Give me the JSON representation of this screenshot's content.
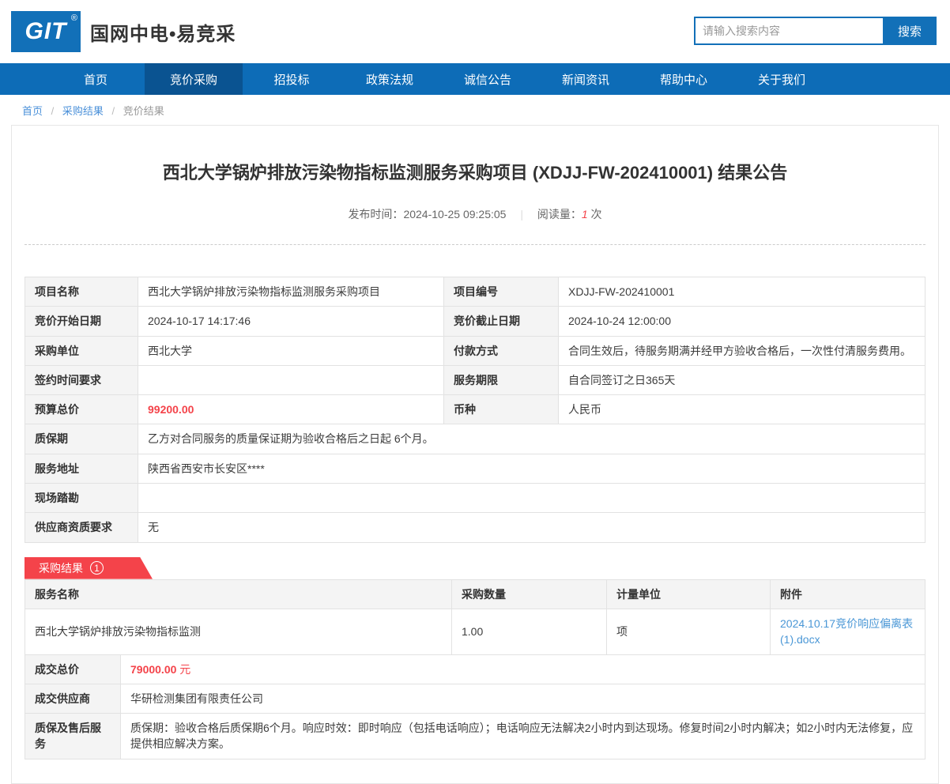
{
  "colors": {
    "primary_blue": "#0d6cb7",
    "active_nav_blue": "#0a5391",
    "logo_blue": "#1270b8",
    "accent_red": "#f4434a",
    "link_blue": "#4a97d6"
  },
  "header": {
    "logo_text": "GIT",
    "logo_registered": "®",
    "site_name": "国网中电•易竞采",
    "search_placeholder": "请输入搜索内容",
    "search_button": "搜索"
  },
  "nav": {
    "items": [
      {
        "label": "首页"
      },
      {
        "label": "竞价采购"
      },
      {
        "label": "招投标"
      },
      {
        "label": "政策法规"
      },
      {
        "label": "诚信公告"
      },
      {
        "label": "新闻资讯"
      },
      {
        "label": "帮助中心"
      },
      {
        "label": "关于我们"
      }
    ]
  },
  "breadcrumb": {
    "home": "首页",
    "sep": "/",
    "level1": "采购结果",
    "level2": "竞价结果"
  },
  "article": {
    "title": "西北大学锅炉排放污染物指标监测服务采购项目 (XDJJ-FW-202410001) 结果公告",
    "publish_label": "发布时间：",
    "publish_time": "2024-10-25 09:25:05",
    "divider": "|",
    "views_label": "阅读量：",
    "views_count": "1",
    "views_unit": "次"
  },
  "details": {
    "project_name_label": "项目名称",
    "project_name": "西北大学锅炉排放污染物指标监测服务采购项目",
    "project_no_label": "项目编号",
    "project_no": "XDJJ-FW-202410001",
    "start_label": "竞价开始日期",
    "start": "2024-10-17 14:17:46",
    "end_label": "竞价截止日期",
    "end": "2024-10-24 12:00:00",
    "buyer_label": "采购单位",
    "buyer": "西北大学",
    "payment_label": "付款方式",
    "payment": "合同生效后，待服务期满并经甲方验收合格后，一次性付清服务费用。",
    "sign_time_label": "签约时间要求",
    "sign_time": "",
    "service_term_label": "服务期限",
    "service_term": "自合同签订之日365天",
    "budget_label": "预算总价",
    "budget": "99200.00",
    "currency_label": "币种",
    "currency": "人民币",
    "warranty_label": "质保期",
    "warranty": "乙方对合同服务的质量保证期为验收合格后之日起 6个月。",
    "address_label": "服务地址",
    "address": "陕西省西安市长安区****",
    "survey_label": "现场踏勘",
    "survey": "",
    "qualification_label": "供应商资质要求",
    "qualification": "无"
  },
  "result": {
    "badge_label": "采购结果",
    "badge_count": "1",
    "headers": [
      "服务名称",
      "采购数量",
      "计量单位",
      "附件"
    ],
    "item": {
      "name": "西北大学锅炉排放污染物指标监测",
      "quantity": "1.00",
      "unit": "项",
      "attachment": "2024.10.17竞价响应偏离表(1).docx"
    },
    "total_label": "成交总价",
    "total_amount": "79000.00",
    "total_unit": "元",
    "supplier_label": "成交供应商",
    "supplier": "华研检测集团有限责任公司",
    "after_sale_label": "质保及售后服务",
    "after_sale": "质保期：验收合格后质保期6个月。响应时效：即时响应（包括电话响应）；电话响应无法解决2小时内到达现场。修复时间2小时内解决；如2小时内无法修复，应提供相应解决方案。"
  }
}
